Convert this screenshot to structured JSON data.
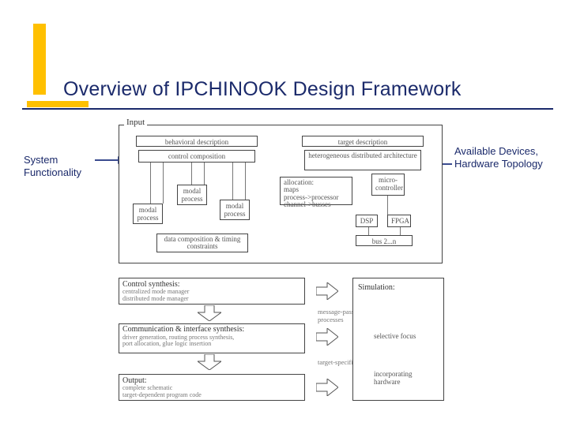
{
  "title": "Overview of IPCHINOOK Design Framework",
  "labels": {
    "left": "System\nFunctionality",
    "right": "Available Devices,\nHardware Topology"
  },
  "diagram": {
    "input_label": "Input",
    "behavioral": "behavioral description",
    "target": "target description",
    "control_comp": "control composition",
    "het_arch": "heterogeneous distributed architecture",
    "allocation": "allocation:\nmaps\nprocess->processor\nchannel->busses",
    "modal_process": "modal process",
    "data_comp": "data composition & timing constraints",
    "microcontroller": "micro-controller",
    "dsp": "DSP",
    "fpga": "FPGA",
    "bus": "bus 2...n",
    "control_synth": {
      "head": "Control synthesis:",
      "sub": "centralized mode manager\ndistributed mode manager"
    },
    "msg_note": "message-passing-only processes",
    "comm_synth": {
      "head": "Communication & interface synthesis:",
      "sub": "driver generation, routing process synthesis,\nport allocation, glue logic insertion"
    },
    "target_note": "target-specific code",
    "output": {
      "head": "Output:",
      "sub": "complete schematic\ntarget-dependent program code"
    },
    "simulation": "Simulation:",
    "sim_sel": "selective focus",
    "sim_inc": "incorporating hardware"
  }
}
